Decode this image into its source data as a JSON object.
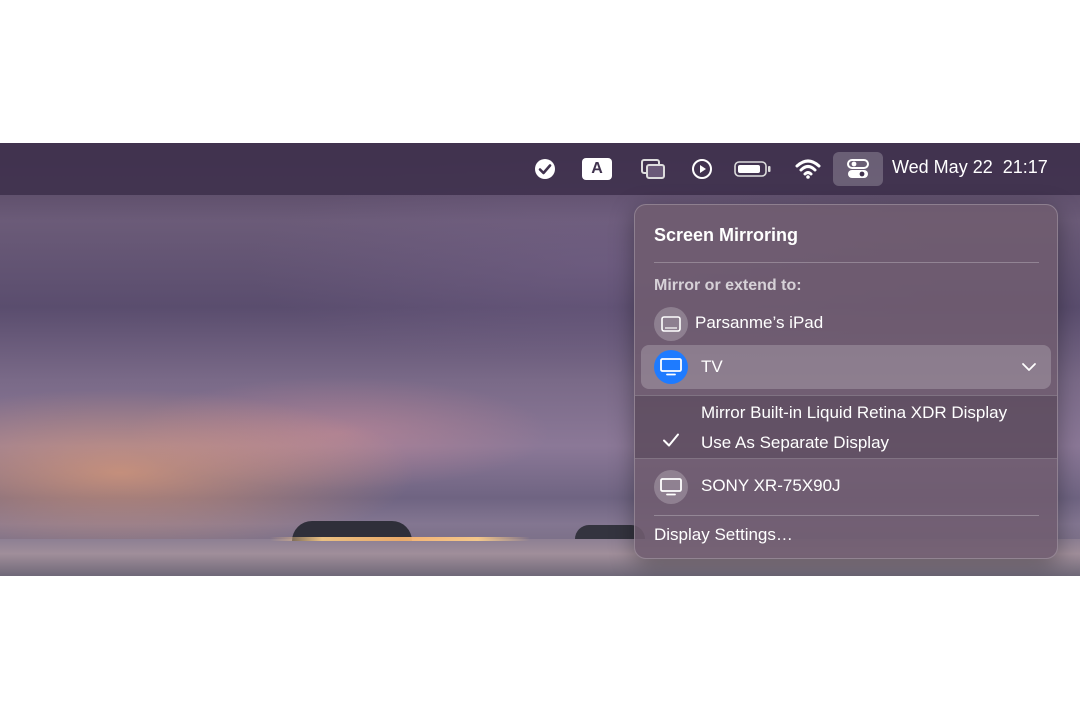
{
  "menubar": {
    "date": "Wed May 22",
    "time": "21:17",
    "input_source_label": "A",
    "icons": [
      "to-do-check-icon",
      "input-source-icon",
      "screen-mirroring-icon",
      "play-icon",
      "battery-icon",
      "wifi-icon",
      "control-center-icon"
    ]
  },
  "panel": {
    "title": "Screen Mirroring",
    "section_label": "Mirror or extend to:",
    "devices": [
      {
        "name": "Parsanme’s iPad",
        "icon": "ipad-icon"
      },
      {
        "name": "TV",
        "icon": "display-icon",
        "selected": true
      },
      {
        "name": "SONY XR-75X90J",
        "icon": "display-icon"
      }
    ],
    "tv_options": [
      {
        "label": "Mirror Built-in Liquid Retina XDR Display",
        "checked": false
      },
      {
        "label": "Use As Separate Display",
        "checked": true
      }
    ],
    "footer_link": "Display Settings…"
  },
  "colors": {
    "accent": "#1e7bff",
    "menubar": "#40324e"
  }
}
